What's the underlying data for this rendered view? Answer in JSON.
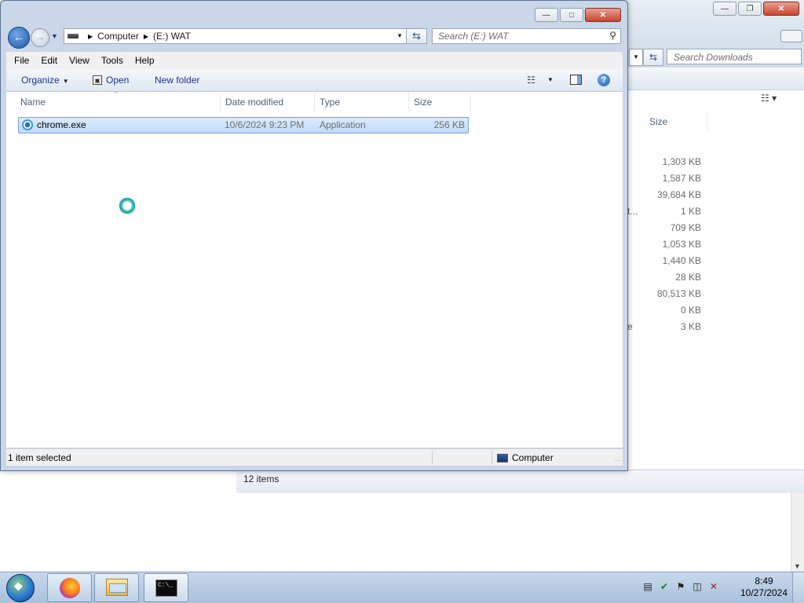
{
  "background_window": {
    "search_placeholder": "Search Downloads",
    "size_header": "Size",
    "sizes": [
      "1,303 KB",
      "1,587 KB",
      "39,684 KB",
      "1 KB",
      "709 KB",
      "1,053 KB",
      "1,440 KB",
      "28 KB",
      "80,513 KB",
      "0 KB",
      "3 KB"
    ],
    "truncated_fragment_1": "t...",
    "truncated_fragment_2": "e",
    "status": "12 items"
  },
  "window": {
    "address": {
      "computer": "Computer",
      "drive": "(E:) WAT"
    },
    "search_placeholder": "Search (E:) WAT",
    "menu": {
      "file": "File",
      "edit": "Edit",
      "view": "View",
      "tools": "Tools",
      "help": "Help"
    },
    "command_bar": {
      "organize": "Organize",
      "open": "Open",
      "new_folder": "New folder"
    },
    "columns": {
      "name": "Name",
      "date": "Date modified",
      "type": "Type",
      "size": "Size"
    },
    "files": [
      {
        "name": "chrome.exe",
        "date": "10/6/2024 9:23 PM",
        "type": "Application",
        "size": "256 KB"
      }
    ],
    "status": {
      "selection": "1 item selected",
      "location": "Computer"
    }
  },
  "taskbar": {
    "apps": [
      "firefox-icon",
      "windows-explorer-icon",
      "command-prompt-icon"
    ],
    "time": "8:49",
    "date": "10/27/2024"
  },
  "colors": {
    "selection": "#c1dcfc",
    "selection_border": "#7da2ce",
    "chrome_bg": "#c9d7e8",
    "taskbar": "#a9c1dc"
  }
}
